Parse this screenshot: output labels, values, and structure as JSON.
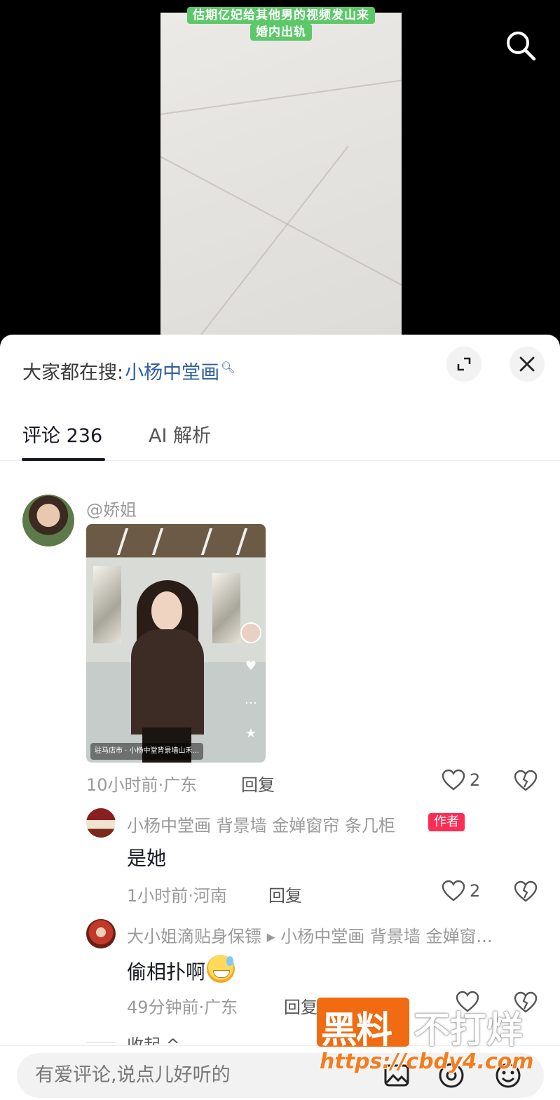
{
  "video": {
    "caption_line1": "估期亿妃给其他男的视频发山来",
    "caption_line2": "婚内出轨",
    "search_icon": "search-icon"
  },
  "sheet": {
    "hot_search_label": "大家都在搜:",
    "hot_search_keyword": "小杨中堂画",
    "tabs": [
      {
        "label": "评论 236",
        "active": true
      },
      {
        "label": "AI 解析",
        "active": false
      }
    ]
  },
  "comments": [
    {
      "user": "@娇姐",
      "image_location": "驻马店市 · 小杨中堂背景墙山禾...",
      "time": "10小时前·广东",
      "reply": "回复",
      "likes": "2"
    },
    {
      "user": "小杨中堂画 背景墙 金婵窗帘 条几柜",
      "badge": "作者",
      "text": "是她",
      "time": "1小时前·河南",
      "reply": "回复",
      "likes": "2"
    },
    {
      "user": "大小姐滴贴身保镖 ▸ 小杨中堂画 背景墙 金婵窗...",
      "text": "偷相扑啊",
      "time": "49分钟前·广东",
      "reply": "回复"
    }
  ],
  "collapse_label": "收起 ^",
  "input": {
    "placeholder": "有爱评论,说点儿好听的"
  },
  "watermark": {
    "brand_a": "黑料",
    "brand_b": "不打烊",
    "url": "https://cbdy4.com"
  },
  "colors": {
    "accent_red": "#fe2c55",
    "link_blue": "#2f5f9e",
    "caption_green": "#5cc86a",
    "watermark_orange": "#f06b12"
  }
}
